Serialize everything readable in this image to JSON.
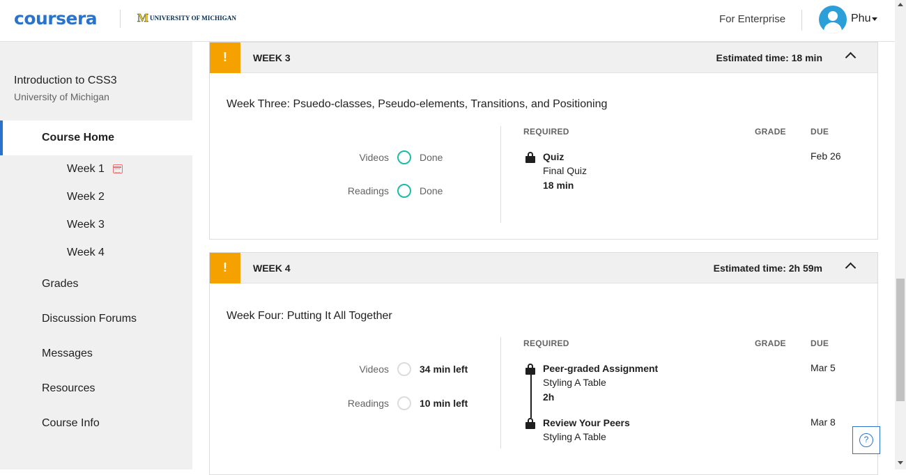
{
  "header": {
    "logo": "coursera",
    "university_mark": "M",
    "university_name": "UNIVERSITY OF MICHIGAN",
    "enterprise_link": "For Enterprise",
    "user_name": "Phu"
  },
  "sidebar": {
    "course_title": "Introduction to CSS3",
    "course_subtitle": "University of Michigan",
    "home": "Course Home",
    "weeks": [
      "Week 1",
      "Week 2",
      "Week 3",
      "Week 4"
    ],
    "items": [
      "Grades",
      "Discussion Forums",
      "Messages",
      "Resources",
      "Course Info"
    ]
  },
  "weeks": [
    {
      "warning": "!",
      "label": "WEEK 3",
      "estimated": "Estimated time: 18 min",
      "title": "Week Three: Psuedo-classes, Pseudo-elements, Transitions, and Positioning",
      "progress": [
        {
          "label": "Videos",
          "status": "Done"
        },
        {
          "label": "Readings",
          "status": "Done"
        }
      ],
      "columns": {
        "required": "REQUIRED",
        "grade": "GRADE",
        "due": "DUE"
      },
      "items": [
        {
          "title": "Quiz",
          "subtitle": "Final Quiz",
          "duration": "18 min",
          "due": "Feb 26"
        }
      ]
    },
    {
      "warning": "!",
      "label": "WEEK 4",
      "estimated": "Estimated time: 2h 59m",
      "title": "Week Four: Putting It All Together",
      "progress": [
        {
          "label": "Videos",
          "status": "34 min left"
        },
        {
          "label": "Readings",
          "status": "10 min left"
        }
      ],
      "columns": {
        "required": "REQUIRED",
        "grade": "GRADE",
        "due": "DUE"
      },
      "items": [
        {
          "title": "Peer-graded Assignment",
          "subtitle": "Styling A Table",
          "duration": "2h",
          "due": "Mar 5"
        },
        {
          "title": "Review Your Peers",
          "subtitle": "Styling A Table",
          "due": "Mar 8"
        }
      ]
    }
  ],
  "help": "?",
  "colors": {
    "brand": "#2a73cc",
    "warning": "#f5a200",
    "done": "#1cbba8",
    "sidebar_bg": "#f0f0f0"
  }
}
